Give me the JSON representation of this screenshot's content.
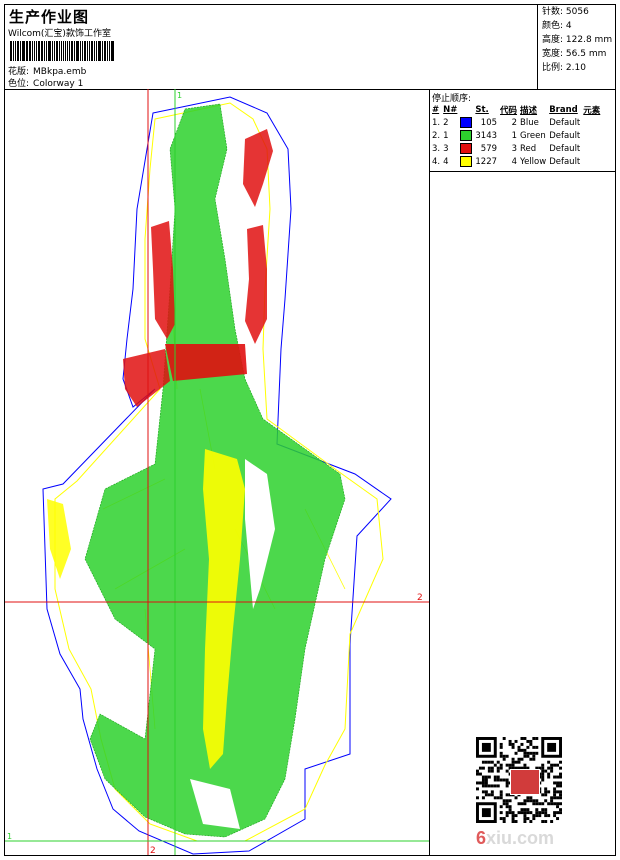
{
  "header": {
    "title": "生产作业图",
    "subtitle": "Wilcom(汇宝)款饰工作室",
    "pattern_label": "花版:",
    "pattern_value": "MBkpa.emb",
    "colorway_label": "色位:",
    "colorway_value": "Colorway 1"
  },
  "stats": [
    {
      "label": "针数:",
      "value": "5056"
    },
    {
      "label": "颜色:",
      "value": "4"
    },
    {
      "label": "高度:",
      "value": "122.8 mm"
    },
    {
      "label": "宽度:",
      "value": "56.5 mm"
    },
    {
      "label": "比例:",
      "value": "2.10"
    }
  ],
  "stop_sequence": {
    "title": "停止顺序:",
    "columns": [
      "#",
      "N#",
      "St.",
      "代码",
      "描述",
      "Brand",
      "元素"
    ],
    "rows": [
      {
        "num": "1.",
        "n": "2",
        "swatch": "#0000ff",
        "st": "105",
        "code": "2",
        "desc": "Blue",
        "brand": "Default"
      },
      {
        "num": "2.",
        "n": "1",
        "swatch": "#2dd12d",
        "st": "3143",
        "code": "1",
        "desc": "Green",
        "brand": "Default"
      },
      {
        "num": "3.",
        "n": "3",
        "swatch": "#e01010",
        "st": "579",
        "code": "3",
        "desc": "Red",
        "brand": "Default"
      },
      {
        "num": "4.",
        "n": "4",
        "swatch": "#ffff00",
        "st": "1227",
        "code": "4",
        "desc": "Yellow",
        "brand": "Default"
      }
    ]
  },
  "guides": {
    "v1_label": "1",
    "v2_label": "2",
    "h1_label": "1",
    "h2_label": "2"
  },
  "thread_colors": {
    "blue": "#0000ff",
    "green": "#2dd12d",
    "red": "#e01010",
    "yellow": "#ffff00"
  },
  "watermark": {
    "part1": "6",
    "part2": "xiu.com"
  }
}
